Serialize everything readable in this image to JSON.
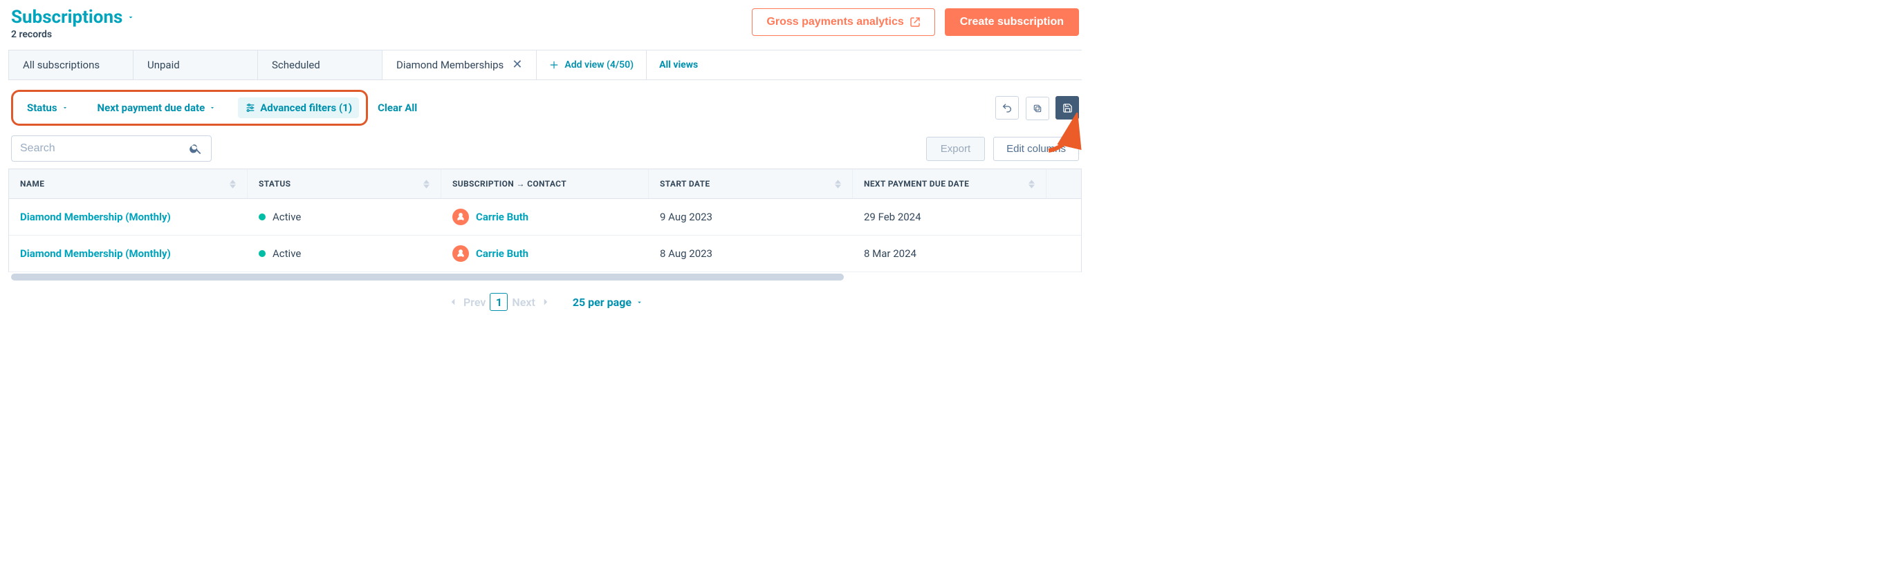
{
  "header": {
    "title": "Subscriptions",
    "record_count": "2 records",
    "gross_payments": "Gross payments analytics",
    "create": "Create subscription"
  },
  "tabs": [
    {
      "label": "All subscriptions",
      "active": false,
      "closable": false
    },
    {
      "label": "Unpaid",
      "active": false,
      "closable": false
    },
    {
      "label": "Scheduled",
      "active": false,
      "closable": false
    },
    {
      "label": "Diamond Memberships",
      "active": true,
      "closable": true
    }
  ],
  "tabs_extra": {
    "add_view": "Add view (4/50)",
    "all_views": "All views"
  },
  "filterbar": {
    "status": "Status",
    "next_due": "Next payment due date",
    "advanced": "Advanced filters (1)",
    "clear_all": "Clear All"
  },
  "search": {
    "placeholder": "Search"
  },
  "actions": {
    "export": "Export",
    "edit_columns": "Edit columns"
  },
  "columns": [
    {
      "key": "name",
      "label": "NAME"
    },
    {
      "key": "status",
      "label": "STATUS"
    },
    {
      "key": "contact",
      "label": "SUBSCRIPTION → CONTACT"
    },
    {
      "key": "start",
      "label": "START DATE"
    },
    {
      "key": "next",
      "label": "NEXT PAYMENT DUE DATE"
    }
  ],
  "rows": [
    {
      "name": "Diamond Membership (Monthly)",
      "status": "Active",
      "status_color": "#00bda5",
      "contact": "Carrie Buth",
      "start": "9 Aug 2023",
      "next": "29 Feb 2024"
    },
    {
      "name": "Diamond Membership (Monthly)",
      "status": "Active",
      "status_color": "#00bda5",
      "contact": "Carrie Buth",
      "start": "8 Aug 2023",
      "next": "8 Mar 2024"
    }
  ],
  "pager": {
    "prev": "Prev",
    "next": "Next",
    "page": "1",
    "per_page": "25 per page"
  }
}
